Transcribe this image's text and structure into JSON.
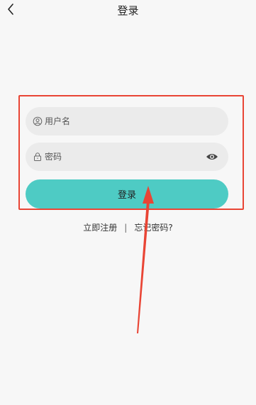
{
  "header": {
    "title": "登录",
    "back_icon": "chevron-left-icon"
  },
  "form": {
    "username_placeholder": "用户名",
    "username_icon": "user-circle-icon",
    "password_placeholder": "密码",
    "password_icon": "lock-icon",
    "password_toggle_icon": "eye-icon",
    "login_label": "登录"
  },
  "links": {
    "register_label": "立即注册",
    "separator": "|",
    "forgot_label": "忘记密码?"
  },
  "annotation": {
    "highlight_color": "#e94535",
    "arrow_color": "#e94535"
  },
  "colors": {
    "accent": "#4ecbc4",
    "field_bg": "#ebebeb",
    "page_bg": "#f7f7f7"
  }
}
